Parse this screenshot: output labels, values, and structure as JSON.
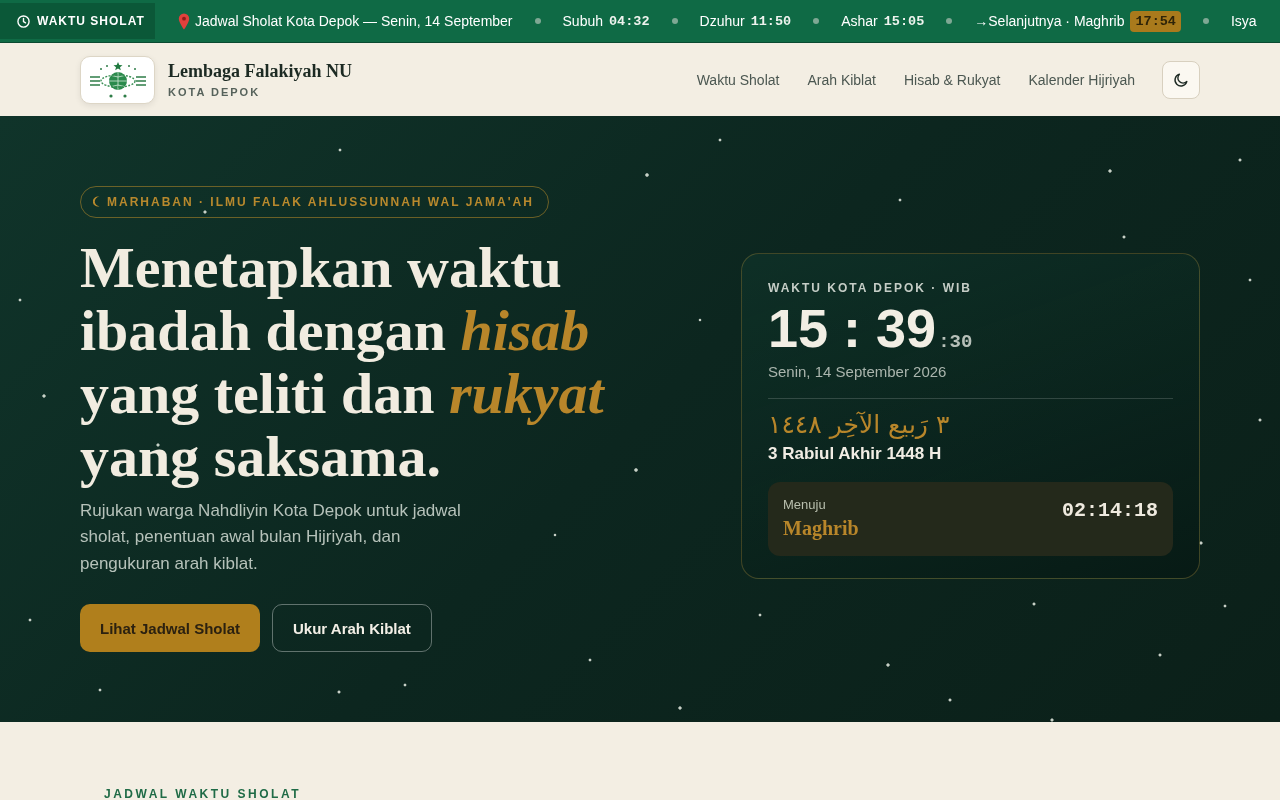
{
  "ticker": {
    "label": "WAKTU SHOLAT",
    "headline": "Jadwal Sholat Kota Depok — Senin, 14 September",
    "prayers": [
      {
        "label": "Subuh",
        "time": "04:32",
        "next": false
      },
      {
        "label": "Dzuhur",
        "time": "11:50",
        "next": false
      },
      {
        "label": "Ashar",
        "time": "15:05",
        "next": false
      },
      {
        "label": "→Selanjutnya · Maghrib",
        "time": "17:54",
        "next": true
      },
      {
        "label": "Isya",
        "next": false
      }
    ]
  },
  "header": {
    "brand": {
      "name": "Lembaga Falakiyah NU",
      "subtitle": "KOTA DEPOK"
    },
    "nav": [
      "Waktu Sholat",
      "Arah Kiblat",
      "Hisab & Rukyat",
      "Kalender Hijriyah"
    ]
  },
  "hero": {
    "badge": "MARHABAN · ILMU FALAK AHLUSSUNNAH WAL JAMA'AH",
    "heading": "Menetapkan waktu ibadah dengan *hisab* yang teliti dan *rukyat* yang saksama.",
    "description": "Rujukan warga Nahdliyin Kota Depok untuk jadwal sholat, penentuan awal bulan Hijriyah, dan pengukuran arah kiblat.",
    "buttons": [
      {
        "label": "Lihat Jadwal Sholat",
        "kind": "primary"
      },
      {
        "label": "Ukur Arah Kiblat",
        "kind": "outline"
      }
    ]
  },
  "clock_card": {
    "caption": "WAKTU KOTA DEPOK · WIB",
    "time": "15 : 39",
    "seconds": ":30",
    "date": "Senin, 14 September 2026",
    "hijri_arabic": "٣ رَبيع الآخِر ١٤٤٨",
    "hijri_latin": "3 Rabiul Akhir 1448 H",
    "countdown": {
      "label": "Menuju",
      "prayer": "Maghrib",
      "remaining": "02:14:18"
    }
  },
  "section": {
    "eyebrow": "JADWAL WAKTU SHOLAT"
  }
}
